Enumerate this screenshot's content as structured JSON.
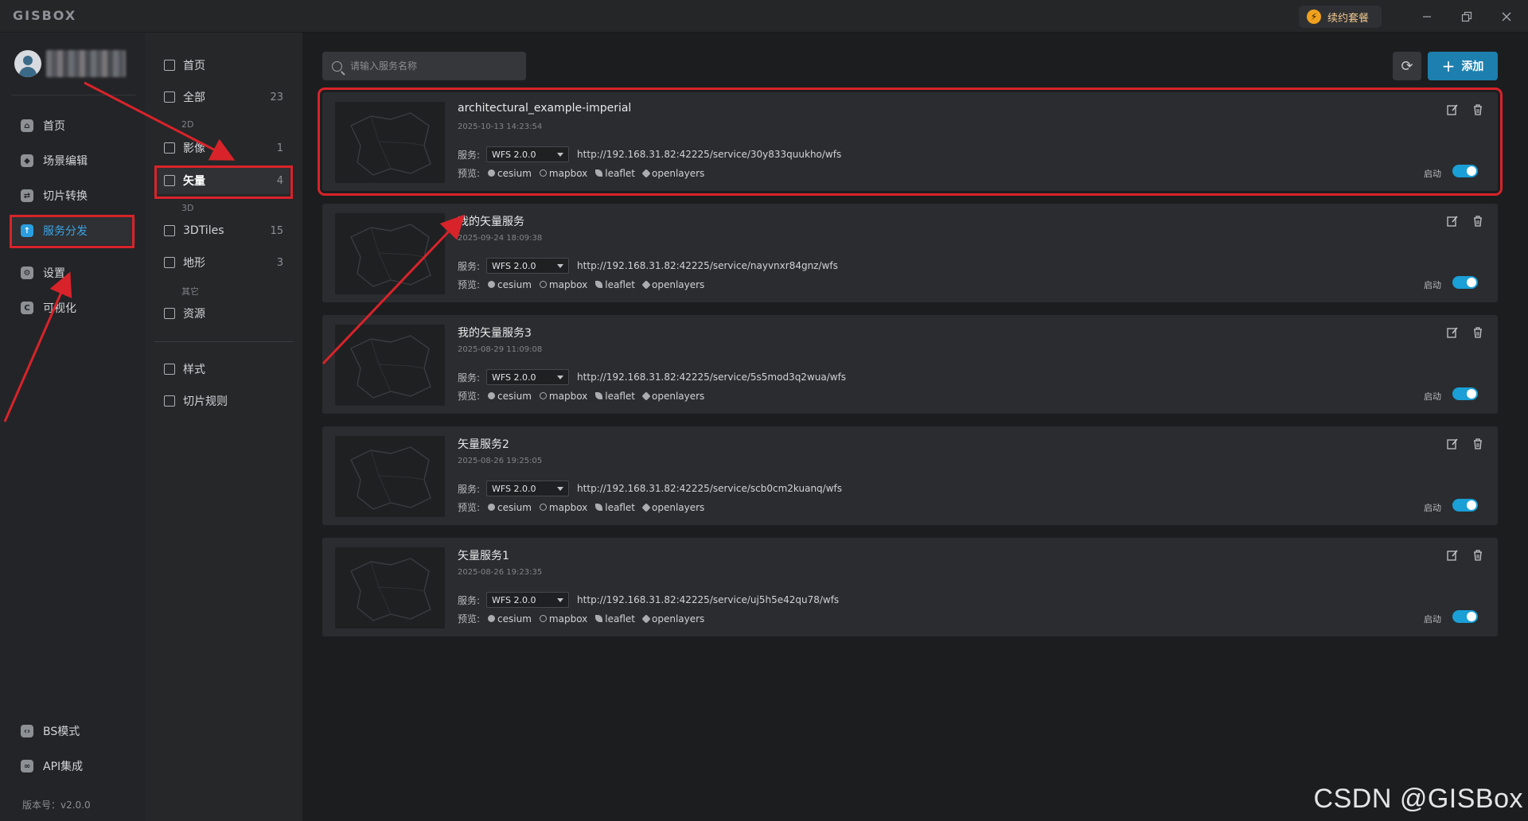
{
  "app": {
    "logo": "GISBOX"
  },
  "titlebar": {
    "renew_label": "续约套餐",
    "renew_icon": "lightning-icon",
    "controls": [
      "minimize-icon",
      "restore-icon",
      "close-icon"
    ]
  },
  "sidebar": {
    "items": [
      {
        "label": "首页",
        "icon": "home-icon"
      },
      {
        "label": "场景编辑",
        "icon": "cube-icon"
      },
      {
        "label": "切片转换",
        "icon": "convert-icon"
      },
      {
        "label": "服务分发",
        "icon": "upload-icon",
        "active": true
      },
      {
        "label": "设置",
        "icon": "gear-icon"
      },
      {
        "label": "可视化",
        "icon": "visual-icon"
      }
    ],
    "bottom_items": [
      {
        "label": "BS模式",
        "icon": "code-icon"
      },
      {
        "label": "API集成",
        "icon": "link-icon"
      }
    ],
    "version": "版本号：v2.0.0"
  },
  "categories": {
    "home": "首页",
    "all": {
      "label": "全部",
      "count": "23"
    },
    "group_2d": "2D",
    "imagery": {
      "label": "影像",
      "count": "1"
    },
    "vector": {
      "label": "矢量",
      "count": "4"
    },
    "group_3d": "3D",
    "tiles3d": {
      "label": "3DTiles",
      "count": "15"
    },
    "terrain": {
      "label": "地形",
      "count": "3"
    },
    "group_other": "其它",
    "resource": "资源",
    "style": "样式",
    "tile_rule": "切片规则"
  },
  "toolbar": {
    "search_placeholder": "请输入服务名称",
    "add_label": "添加"
  },
  "labels": {
    "service": "服务:",
    "preview": "预览:",
    "enable": "启动"
  },
  "preview_links": [
    "cesium",
    "mapbox",
    "leaflet",
    "openlayers"
  ],
  "services": [
    {
      "name": "architectural_example-imperial",
      "date": "2025-10-13 14:23:54",
      "protocol": "WFS 2.0.0",
      "url": "http://192.168.31.82:42225/service/30y833quukho/wfs",
      "enabled": true
    },
    {
      "name": "我的矢量服务",
      "date": "2025-09-24 18:09:38",
      "protocol": "WFS 2.0.0",
      "url": "http://192.168.31.82:42225/service/nayvnxr84gnz/wfs",
      "enabled": true
    },
    {
      "name": "我的矢量服务3",
      "date": "2025-08-29 11:09:08",
      "protocol": "WFS 2.0.0",
      "url": "http://192.168.31.82:42225/service/5s5mod3q2wua/wfs",
      "enabled": true
    },
    {
      "name": "矢量服务2",
      "date": "2025-08-26 19:25:05",
      "protocol": "WFS 2.0.0",
      "url": "http://192.168.31.82:42225/service/scb0cm2kuanq/wfs",
      "enabled": true
    },
    {
      "name": "矢量服务1",
      "date": "2025-08-26 19:23:35",
      "protocol": "WFS 2.0.0",
      "url": "http://192.168.31.82:42225/service/uj5h5e42qu78/wfs",
      "enabled": true
    }
  ],
  "watermark": "CSDN @GISBox",
  "colors": {
    "accent": "#1a9fd6",
    "annotation": "#d8232a",
    "primary_button": "#1d7fae"
  }
}
